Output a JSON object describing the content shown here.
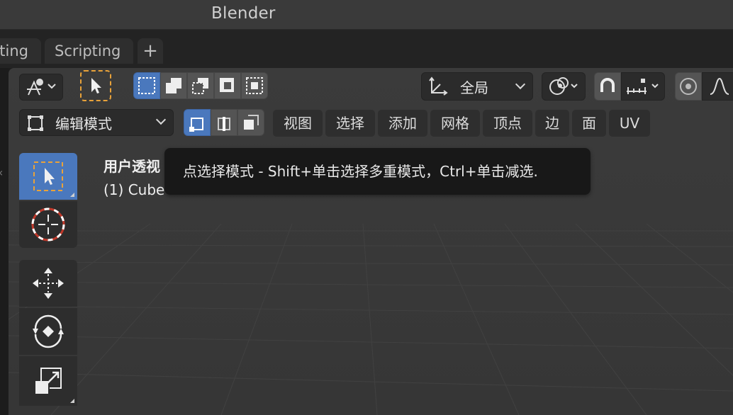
{
  "window": {
    "title": "Blender"
  },
  "workspace_tabs": {
    "partial_label": "ting",
    "scripting_label": "Scripting",
    "add_label": "+"
  },
  "header": {
    "orientation_label": "全局",
    "mode_label": "编辑模式",
    "menus": [
      "视图",
      "选择",
      "添加",
      "网格",
      "顶点",
      "边",
      "面",
      "UV"
    ]
  },
  "viewport": {
    "view_name": "用户透视",
    "object_name": "(1) Cube"
  },
  "tooltip": {
    "text": "点选择模式 - Shift+单击选择多重模式，Ctrl+单击减选."
  },
  "colors": {
    "accent": "#4a78bd",
    "select_box": "#e8a23a",
    "cursor_red": "#c0392b"
  },
  "icons": {
    "select_tool": "select-cursor-icon",
    "cursor_tool": "3d-cursor-icon",
    "move_tool": "move-icon",
    "rotate_tool": "rotate-icon",
    "scale_tool": "scale-icon"
  }
}
